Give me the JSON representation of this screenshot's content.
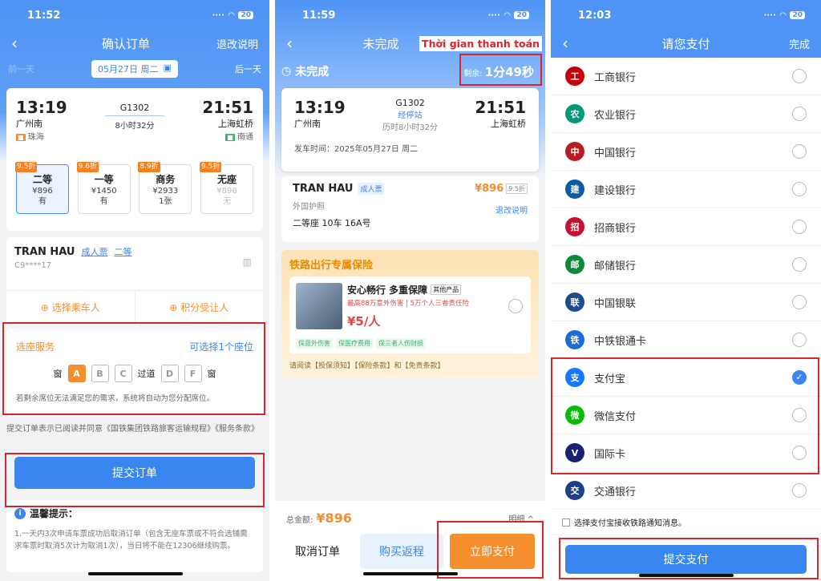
{
  "p1": {
    "time": "11:52",
    "battery": "20",
    "title": "确认订单",
    "right": "退改说明",
    "prev": "前一天",
    "date": "05月27日 周二",
    "next": "后一天",
    "dep_time": "13:19",
    "dep_station": "广州南",
    "dep_sub": "珠海",
    "train": "G1302",
    "duration": "8小时32分",
    "arr_time": "21:51",
    "arr_station": "上海虹桥",
    "arr_sub": "南通",
    "seats": [
      {
        "disc": "9.5折",
        "name": "二等",
        "price": "¥896",
        "avail": "有"
      },
      {
        "disc": "9.6折",
        "name": "一等",
        "price": "¥1450",
        "avail": "有"
      },
      {
        "disc": "8.9折",
        "name": "商务",
        "price": "¥2933",
        "avail": "1张"
      },
      {
        "disc": "9.5折",
        "name": "无座",
        "price": "¥896",
        "avail": "无"
      }
    ],
    "pax_name": "TRAN   HAU",
    "pax_type": "成人票",
    "pax_class": "二等",
    "pax_id": "C9****17",
    "add_pax": "选择乘车人",
    "points": "积分受让人",
    "seat_title": "选座服务",
    "seat_hint": "可选择1个座位",
    "window": "窗",
    "aisle": "过道",
    "seat_letters": [
      "A",
      "B",
      "C",
      "D",
      "F"
    ],
    "seat_note": "若剩余席位无法满足您的需求，系统将自动为您分配席位。",
    "agree": "提交订单表示已阅读并同意《国铁集团铁路旅客运输规程》《服务条款》",
    "submit": "提交订单",
    "tips_title": "温馨提示：",
    "tips_text": "1.一天内3次申请车票成功后取消订单（包含无座车票或不符合选铺需求车票时取消5次计为取消1次），当日将不能在12306继续购票。"
  },
  "p2": {
    "time": "11:59",
    "battery": "20",
    "title": "未完成",
    "overlay": "Thời gian thanh toán",
    "status": "未完成",
    "remain_label": "剩余:",
    "remain_value": "1分49秒",
    "dep_time": "13:19",
    "dep_station": "广州南",
    "train": "G1302",
    "via": "经停站",
    "duration": "历时8小时32分",
    "arr_time": "21:51",
    "arr_station": "上海虹桥",
    "depart_time": "发车时间：2025年05月27日 周二",
    "pax_name": "TRAN   HAU",
    "pax_type": "成人票",
    "price": "¥896",
    "disc": "9.5折",
    "doc": "外国护照",
    "refund": "退改说明",
    "seat_info": "二等座 10车 16A号",
    "ins_banner": "铁路出行专属保险",
    "ins_name": "安心畅行 多重保障",
    "ins_other": "其他产品",
    "ins_desc": "最高88万意外伤害 | 5万个人三者责任险",
    "ins_price": "¥5/人",
    "ins_tags": [
      "保意外伤害",
      "保医疗费用",
      "保三者人伤财损"
    ],
    "ins_read": "请阅读【投保须知】【保险条款】和【免责条款】",
    "total_label": "总金额:",
    "total": "¥896",
    "detail": "明细",
    "cancel": "取消订单",
    "return": "购买返程",
    "pay": "立即支付"
  },
  "p3": {
    "time": "12:03",
    "battery": "20",
    "title": "请您支付",
    "right": "完成",
    "banks": [
      {
        "name": "工商银行",
        "color": "#c7000b",
        "icon": "工"
      },
      {
        "name": "农业银行",
        "color": "#009a7a",
        "icon": "农"
      },
      {
        "name": "中国银行",
        "color": "#b81c22",
        "icon": "中"
      },
      {
        "name": "建设银行",
        "color": "#0a5ba8",
        "icon": "建"
      },
      {
        "name": "招商银行",
        "color": "#c8102e",
        "icon": "招"
      },
      {
        "name": "邮储银行",
        "color": "#0a8a3a",
        "icon": "邮"
      },
      {
        "name": "中国银联",
        "color": "#1e4c8f",
        "icon": "联"
      },
      {
        "name": "中铁银通卡",
        "color": "#1e6ad6",
        "icon": "铁"
      }
    ],
    "pays": [
      {
        "name": "支付宝",
        "color": "#1677ff",
        "icon": "支",
        "on": true
      },
      {
        "name": "微信支付",
        "color": "#09bb07",
        "icon": "微",
        "on": false
      },
      {
        "name": "国际卡",
        "color": "#1a1f71",
        "icon": "V",
        "on": false
      }
    ],
    "bank9": {
      "name": "交通银行",
      "color": "#1d3f8c",
      "icon": "交"
    },
    "notify": "选择支付宝接收铁路通知消息。",
    "submit": "提交支付"
  },
  "colors": {
    "primary": "#3a86f0",
    "red": "#d9262c",
    "orange": "#f58e2c"
  }
}
